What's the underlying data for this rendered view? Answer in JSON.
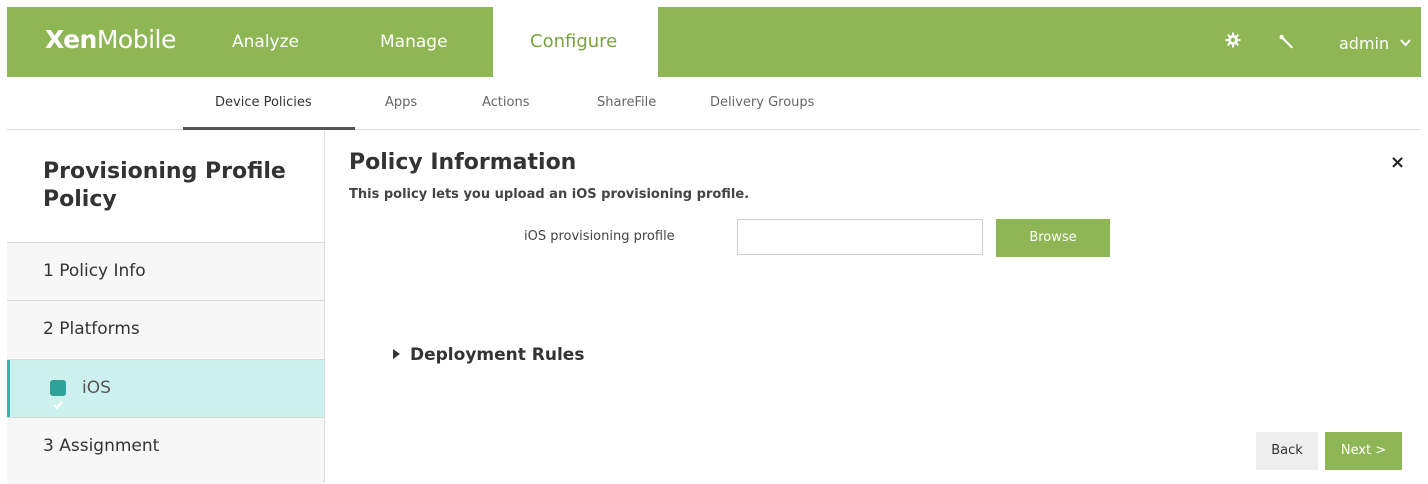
{
  "header": {
    "logo_bold": "Xen",
    "logo_light": "Mobile",
    "nav": [
      "Analyze",
      "Manage",
      "Configure"
    ],
    "active_nav": "Configure",
    "user": "admin",
    "icons": [
      "gear-icon",
      "wrench-icon",
      "chevron-down-icon"
    ]
  },
  "subnav": {
    "items": [
      "Device Policies",
      "Apps",
      "Actions",
      "ShareFile",
      "Delivery Groups"
    ],
    "active": "Device Policies"
  },
  "sidebar": {
    "title": "Provisioning Profile Policy",
    "items": [
      {
        "label": "1 Policy Info"
      },
      {
        "label": "2 Platforms"
      },
      {
        "label": "iOS",
        "checked": true
      },
      {
        "label": "3 Assignment"
      }
    ]
  },
  "main": {
    "title": "Policy Information",
    "subtitle": "This policy lets you upload an iOS provisioning profile.",
    "field_label": "iOS provisioning profile",
    "field_value": "",
    "browse_label": "Browse",
    "deployment_rules": "Deployment Rules",
    "back_label": "Back",
    "next_label": "Next >",
    "close_symbol": "×"
  },
  "colors": {
    "brand_green": "#8fb655",
    "active_teal": "#cdf1ef",
    "check_teal": "#2fa39a"
  }
}
